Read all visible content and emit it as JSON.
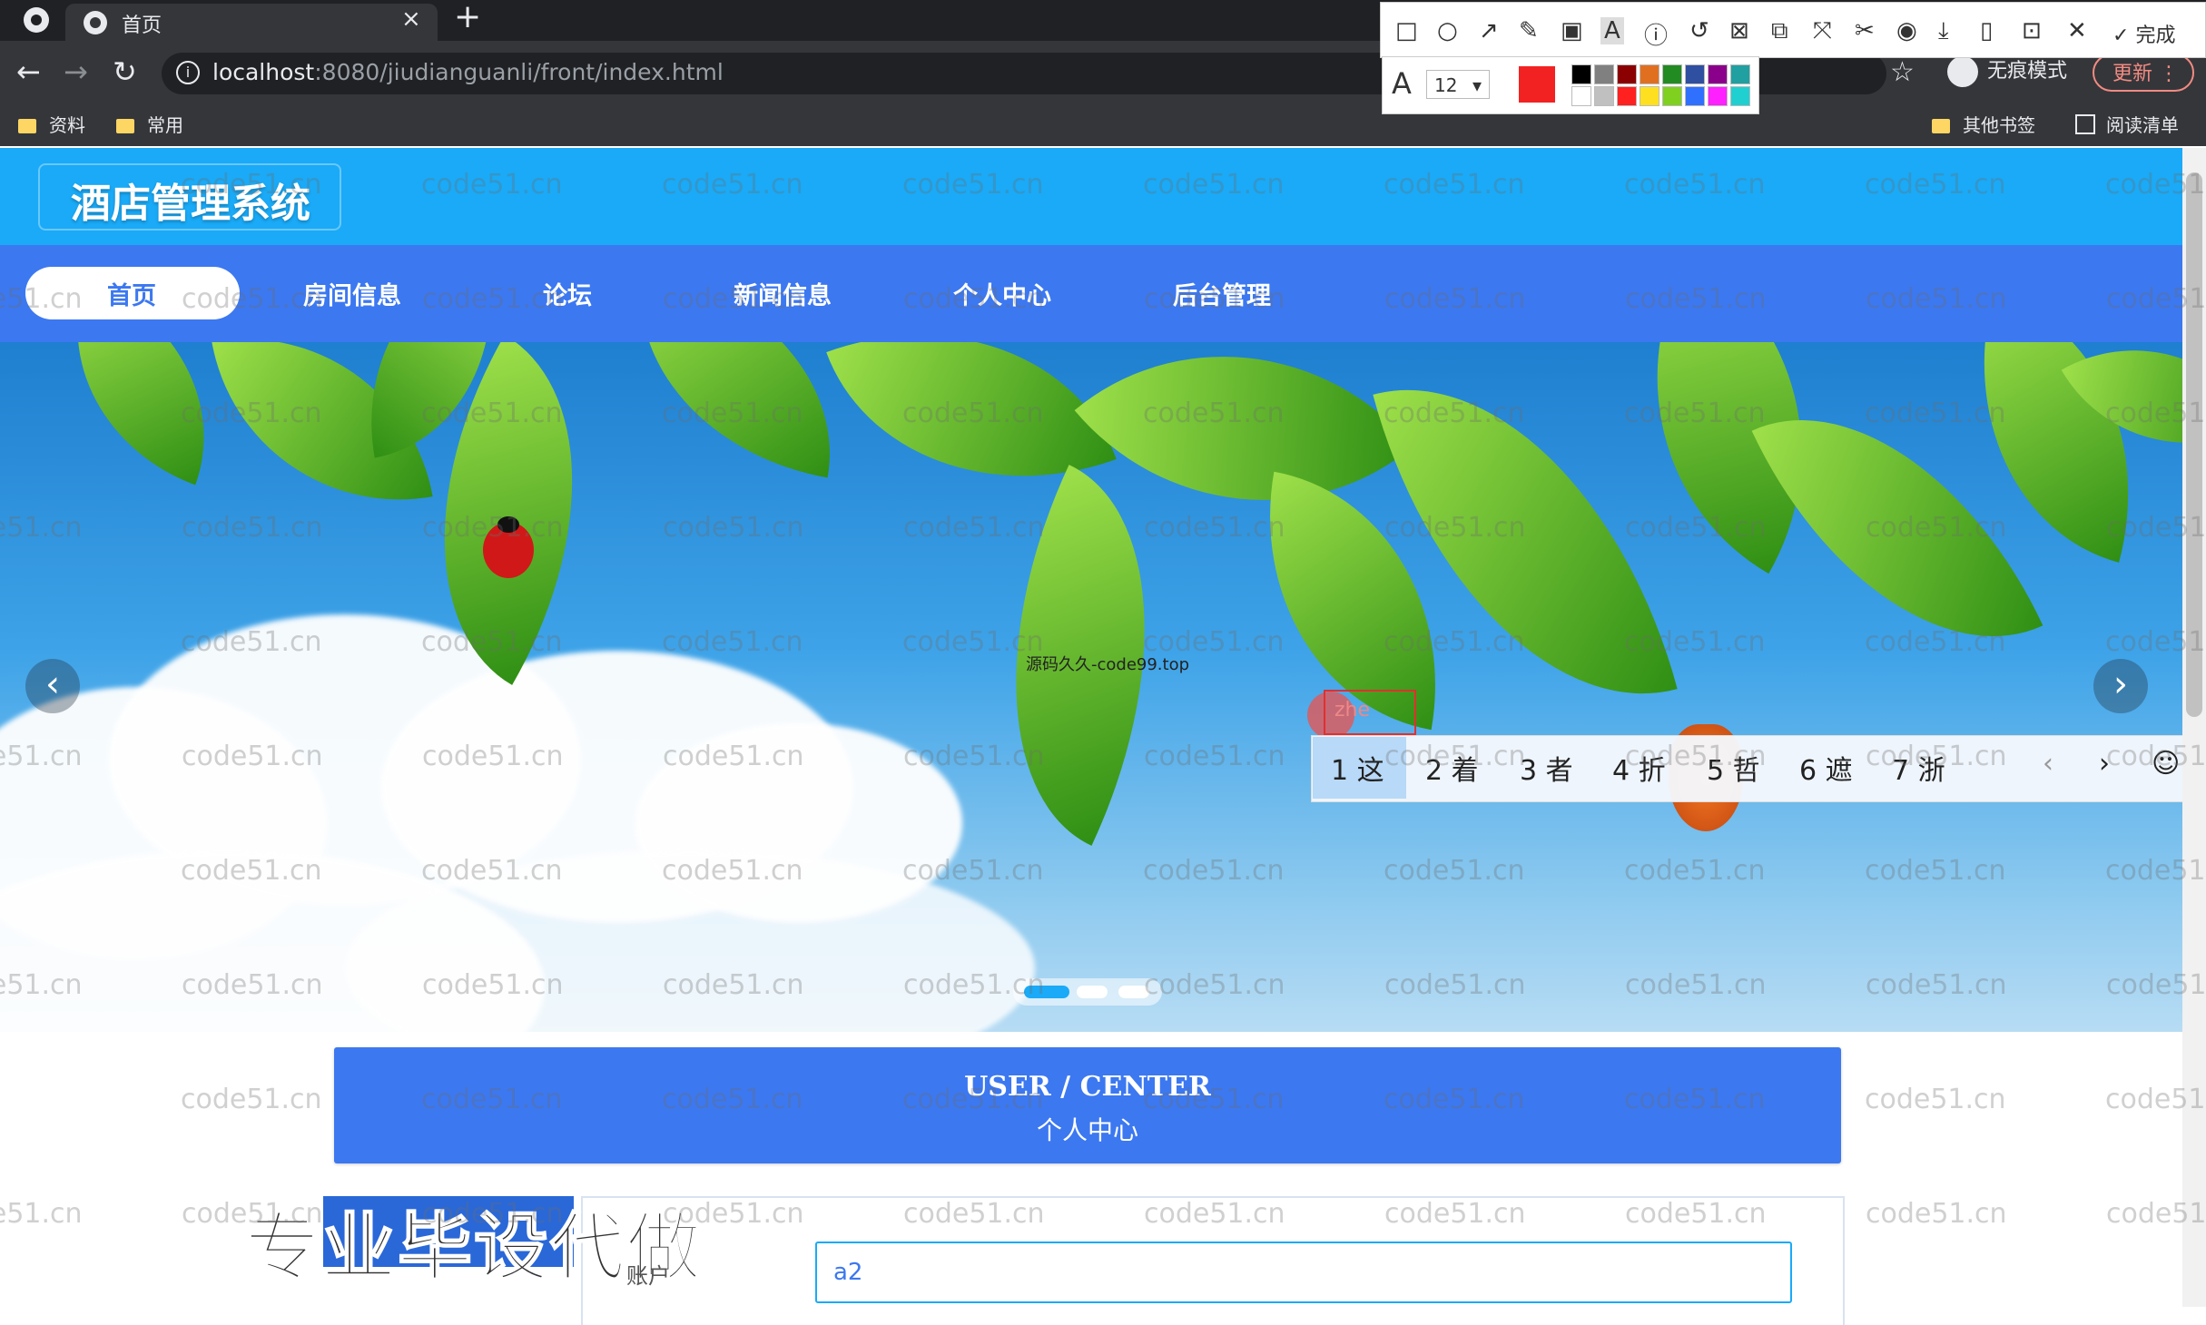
{
  "browser": {
    "tab_title": "首页",
    "tab_close": "×",
    "new_tab": "+",
    "url_host": "localhost",
    "url_rest": ":8080/jiudianguanli/front/index.html",
    "back_icon": "←",
    "forward_icon": "→",
    "reload_icon": "↻",
    "star_icon": "☆",
    "incognito_label": "无痕模式",
    "update_label": "更新",
    "update_menu": "⋮",
    "bookmarks": [
      "资料",
      "常用"
    ],
    "bookmarks_right": [
      "其他书签",
      "阅读清单"
    ]
  },
  "screenshot_tool": {
    "icons": [
      "□",
      "○",
      "↗",
      "✎",
      "▣",
      "A",
      "ⓘ",
      "↺",
      "⊠",
      "⧉",
      "⤧",
      "✂",
      "◉",
      "⤓",
      "▯",
      "⊡",
      "✕"
    ],
    "done_label": "完成",
    "font_icon": "A",
    "font_size": "12",
    "current_color": "#f22222",
    "palette": [
      "#000000",
      "#808080",
      "#8b0000",
      "#e07020",
      "#228b22",
      "#2f4fa0",
      "#8b008b",
      "#20a0a0",
      "#ffffff",
      "#c0c0c0",
      "#ff2020",
      "#ffe020",
      "#80d020",
      "#3070ff",
      "#ff20ff",
      "#20d0d0"
    ]
  },
  "site": {
    "title": "酒店管理系统",
    "nav": [
      "首页",
      "房间信息",
      "论坛",
      "新闻信息",
      "个人中心",
      "后台管理"
    ],
    "banner_caption": "源码久久-code99.top",
    "prev_icon": "‹",
    "next_icon": "›",
    "user_center_en": "USER / CENTER",
    "user_center_cn": "个人中心",
    "account_label": "账户",
    "account_value": "a2",
    "ad_text": "专业毕设代做",
    "watermark": "code51.cn"
  },
  "ime": {
    "input": "zhe",
    "candidates": [
      "1 这",
      "2 着",
      "3 者",
      "4 折",
      "5 哲",
      "6 遮",
      "7 浙"
    ],
    "prev": "‹",
    "next": "›",
    "emoji_icon": "☺"
  }
}
